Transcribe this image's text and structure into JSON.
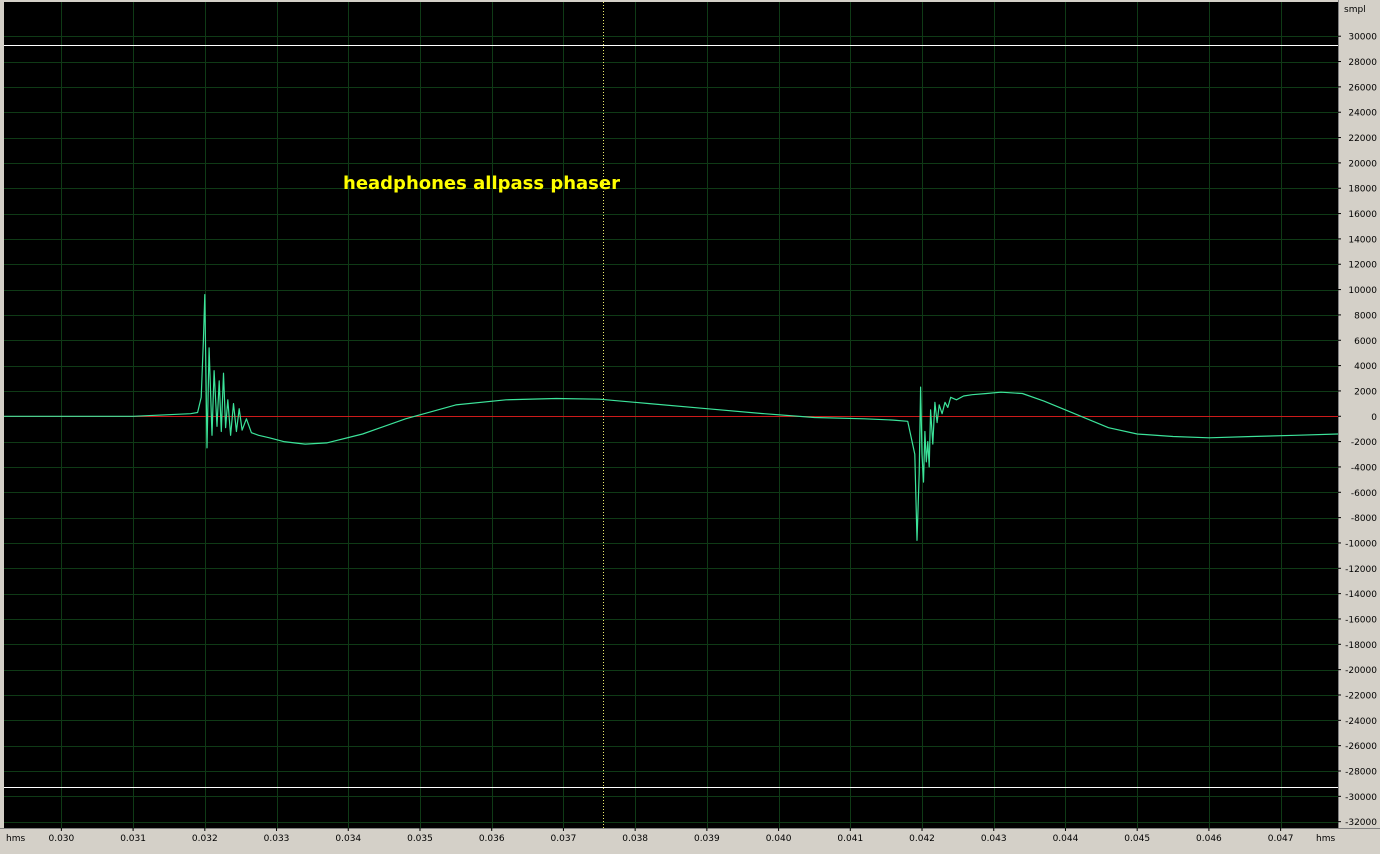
{
  "chart_data": {
    "type": "line",
    "title": "headphones allpass phaser",
    "xlabel": "hms",
    "ylabel": "smpl",
    "xlim": [
      0.0292,
      0.0478
    ],
    "ylim": [
      -32500,
      32700
    ],
    "grid": true,
    "x_ticks": [
      0.03,
      0.031,
      0.032,
      0.033,
      0.034,
      0.035,
      0.036,
      0.037,
      0.038,
      0.039,
      0.04,
      0.041,
      0.042,
      0.043,
      0.044,
      0.045,
      0.046,
      0.047
    ],
    "x_tick_labels": [
      "0.030",
      "0.031",
      "0.032",
      "0.033",
      "0.034",
      "0.035",
      "0.036",
      "0.037",
      "0.038",
      "0.039",
      "0.040",
      "0.041",
      "0.042",
      "0.043",
      "0.044",
      "0.045",
      "0.046",
      "0.047"
    ],
    "y_ticks": [
      30000,
      28000,
      26000,
      24000,
      22000,
      20000,
      18000,
      16000,
      14000,
      12000,
      10000,
      8000,
      6000,
      4000,
      2000,
      0,
      -2000,
      -4000,
      -6000,
      -8000,
      -10000,
      -12000,
      -14000,
      -16000,
      -18000,
      -20000,
      -22000,
      -24000,
      -26000,
      -28000,
      -30000,
      -32000
    ],
    "y_tick_labels": [
      "30000",
      "28000",
      "26000",
      "24000",
      "22000",
      "20000",
      "18000",
      "16000",
      "14000",
      "12000",
      "10000",
      "8000",
      "6000",
      "4000",
      "2000",
      "0",
      "-2000",
      "-4000",
      "-6000",
      "-8000",
      "-10000",
      "-12000",
      "-14000",
      "-16000",
      "-18000",
      "-20000",
      "-22000",
      "-24000",
      "-26000",
      "-28000",
      "-30000",
      "-32000"
    ],
    "clip_levels": [
      29300,
      -29300
    ],
    "cursor_x": 0.03755,
    "zero_line": 0,
    "series": [
      {
        "x": [
          0.0292,
          0.031,
          0.0318,
          0.0319,
          0.03195,
          0.03198,
          0.032,
          0.03203,
          0.03206,
          0.0321,
          0.03213,
          0.03217,
          0.0322,
          0.03223,
          0.03226,
          0.03229,
          0.03232,
          0.03236,
          0.0324,
          0.03244,
          0.03248,
          0.03252,
          0.03258,
          0.03265,
          0.03275,
          0.0329,
          0.0331,
          0.0334,
          0.0337,
          0.0342,
          0.0348,
          0.0355,
          0.0362,
          0.0369,
          0.0375,
          0.0382,
          0.039,
          0.0398,
          0.0405,
          0.0412,
          0.0416,
          0.0418,
          0.0419,
          0.04193,
          0.04196,
          0.04198,
          0.042,
          0.04202,
          0.04204,
          0.04206,
          0.04208,
          0.0421,
          0.04212,
          0.04215,
          0.04218,
          0.04221,
          0.04224,
          0.04228,
          0.04232,
          0.04236,
          0.0424,
          0.04248,
          0.04258,
          0.0427,
          0.0429,
          0.0431,
          0.0434,
          0.0437,
          0.044,
          0.0443,
          0.0446,
          0.045,
          0.0455,
          0.046,
          0.0466,
          0.0472,
          0.0478
        ],
        "y": [
          0,
          0,
          200,
          300,
          1500,
          6000,
          9600,
          -2500,
          5400,
          -1500,
          3600,
          -800,
          2800,
          -1200,
          3400,
          -900,
          1300,
          -1500,
          1000,
          -1200,
          600,
          -1100,
          -200,
          -1300,
          -1500,
          -1700,
          -2000,
          -2200,
          -2100,
          -1400,
          -200,
          900,
          1300,
          1400,
          1350,
          1000,
          600,
          200,
          -100,
          -200,
          -300,
          -400,
          -3000,
          -9800,
          -4500,
          2300,
          -3000,
          -5200,
          -1200,
          -3600,
          -2000,
          -4000,
          500,
          -2200,
          1100,
          -500,
          900,
          200,
          1100,
          700,
          1500,
          1300,
          1600,
          1700,
          1800,
          1900,
          1800,
          1200,
          500,
          -200,
          -900,
          -1400,
          -1600,
          -1700,
          -1600,
          -1500,
          -1400
        ]
      }
    ]
  }
}
